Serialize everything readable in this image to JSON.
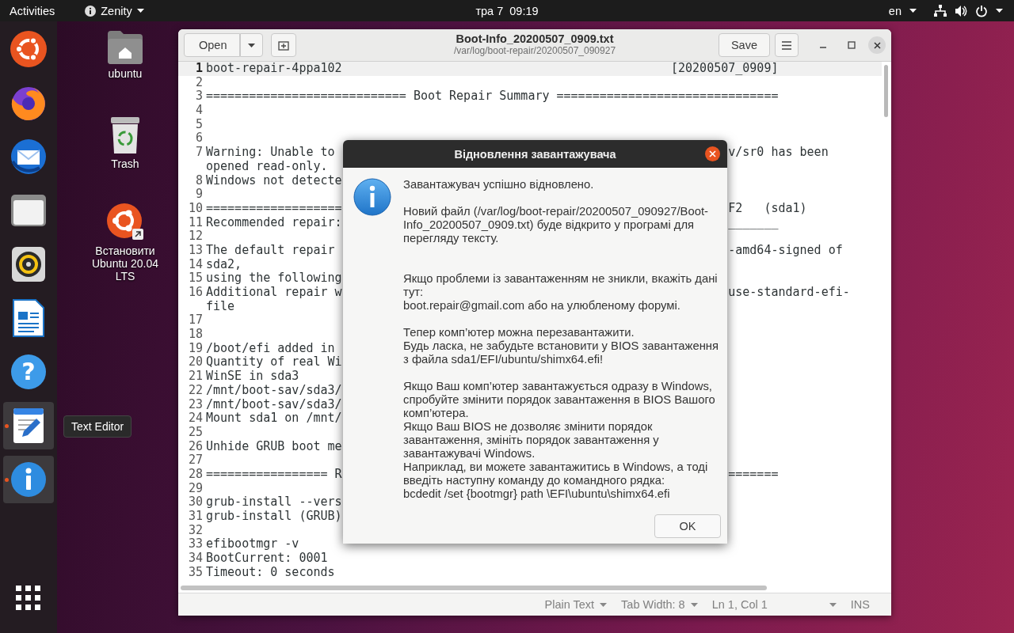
{
  "top_bar": {
    "activities": "Activities",
    "app_menu": "Zenity",
    "clock": "тра 7  09:19",
    "input_source": "en"
  },
  "dock": [
    {
      "kind": "installer",
      "running": false
    },
    {
      "kind": "browser",
      "running": false
    },
    {
      "kind": "mail",
      "running": false
    },
    {
      "kind": "files",
      "running": false
    },
    {
      "kind": "music",
      "running": false
    },
    {
      "kind": "writer",
      "running": false
    },
    {
      "kind": "help",
      "running": false,
      "glyph": "?"
    },
    {
      "kind": "editor",
      "running": true
    },
    {
      "kind": "info",
      "running": true
    },
    {
      "kind": "apps",
      "running": false
    }
  ],
  "tooltip": "Text Editor",
  "desktop_icons": [
    {
      "kind": "home",
      "label": "ubuntu"
    },
    {
      "kind": "trash",
      "label": "Trash"
    },
    {
      "kind": "installer",
      "label": "Встановити Ubuntu 20.04 LTS"
    }
  ],
  "editor": {
    "open_button": "Open",
    "title": "Boot-Info_20200507_0909.txt",
    "subtitle": "/var/log/boot-repair/20200507_090927",
    "save_button": "Save",
    "lines": [
      {
        "number": "1",
        "text": "boot-repair-4ppa102                                              [20200507_0909]",
        "current": true
      },
      {
        "number": "2",
        "current": false
      },
      {
        "number": "3",
        "text": "============================ Boot Repair Summary ===============================",
        "current": false
      },
      {
        "number": "4",
        "current": false
      },
      {
        "number": "5",
        "current": false
      },
      {
        "number": "6",
        "current": false
      },
      {
        "number": "7",
        "text": "Warning: Unable to",
        "right": "v/sr0 has been",
        "wrap": "opened read-only.",
        "current": false
      },
      {
        "number": "8",
        "text": "Windows not detecte",
        "current": false
      },
      {
        "number": "9",
        "current": false
      },
      {
        "number": "10",
        "text": "===================",
        "right": "F2   (sda1)",
        "current": false
      },
      {
        "number": "11",
        "text": "Recommended repair:",
        "right": "_______",
        "current": false
      },
      {
        "number": "12",
        "current": false
      },
      {
        "number": "13",
        "text": "The default repair",
        "right": "-amd64-signed of",
        "current": false
      },
      {
        "number": "14",
        "text": "sda2,",
        "current": false
      },
      {
        "number": "15",
        "text": "using the following",
        "current": false
      },
      {
        "number": "16",
        "text": "Additional repair w",
        "right": "use-standard-efi-",
        "wrap": "file",
        "current": false
      },
      {
        "number": "17",
        "current": false
      },
      {
        "number": "18",
        "current": false
      },
      {
        "number": "19",
        "text": "/boot/efi added in",
        "current": false
      },
      {
        "number": "20",
        "text": "Quantity of real Wi",
        "current": false
      },
      {
        "number": "21",
        "text": "WinSE in sda3",
        "current": false
      },
      {
        "number": "22",
        "text": "/mnt/boot-sav/sda3/",
        "current": false
      },
      {
        "number": "23",
        "text": "/mnt/boot-sav/sda3/",
        "current": false
      },
      {
        "number": "24",
        "text": "Mount sda1 on /mnt/",
        "current": false
      },
      {
        "number": "25",
        "current": false
      },
      {
        "number": "26",
        "text": "Unhide GRUB boot me",
        "current": false
      },
      {
        "number": "27",
        "current": false
      },
      {
        "number": "28",
        "text": "================= R",
        "right": "=======",
        "current": false
      },
      {
        "number": "29",
        "current": false
      },
      {
        "number": "30",
        "text": "grub-install --vers",
        "current": false
      },
      {
        "number": "31",
        "text": "grub-install (GRUB)",
        "current": false
      },
      {
        "number": "32",
        "current": false
      },
      {
        "number": "33",
        "text": "efibootmgr -v",
        "current": false
      },
      {
        "number": "34",
        "text": "BootCurrent: 0001",
        "current": false
      },
      {
        "number": "35",
        "text": "Timeout: 0 seconds",
        "current": false
      }
    ],
    "status_bar": [
      {
        "label": "Plain Text",
        "dropdown": true
      },
      {
        "label": "Tab Width: 8",
        "dropdown": true
      },
      {
        "label": "Ln 1, Col 1",
        "dropdown": false
      },
      {
        "dropdown": true
      },
      {
        "label": "INS",
        "dropdown": false
      }
    ]
  },
  "dialog": {
    "title": "Відновлення завантажувача",
    "paragraphs": [
      "Завантажувач успішно відновлено.",
      "Новий файл (/var/log/boot-repair/20200507_090927/Boot-Info_20200507_0909.txt) буде відкрито у програмі для перегляду тексту.",
      "Якщо проблеми із завантаженням не зникли, вкажіть дані тут:\nboot.repair@gmail.com або на улюбленому форумі.",
      "Тепер комп’ютер можна перезавантажити.\nБудь ласка, не забудьте встановити у BIOS завантаження з файла sda1/EFI/ubuntu/shimx64.efi!",
      "Якщо Ваш комп’ютер завантажується одразу в Windows, спробуйте змінити порядок завантаження в BIOS Вашого комп’ютера.\nЯкщо Ваш BIOS не дозволяє змінити порядок завантаження, змініть порядок завантаження у завантажувачі Windows.\nНаприклад, ви можете завантажитись в Windows, а тоді введіть наступну команду до командного рядка:\nbcdedit /set {bootmgr} path \\EFI\\ubuntu\\shimx64.efi"
    ],
    "ok_button": "OK"
  }
}
